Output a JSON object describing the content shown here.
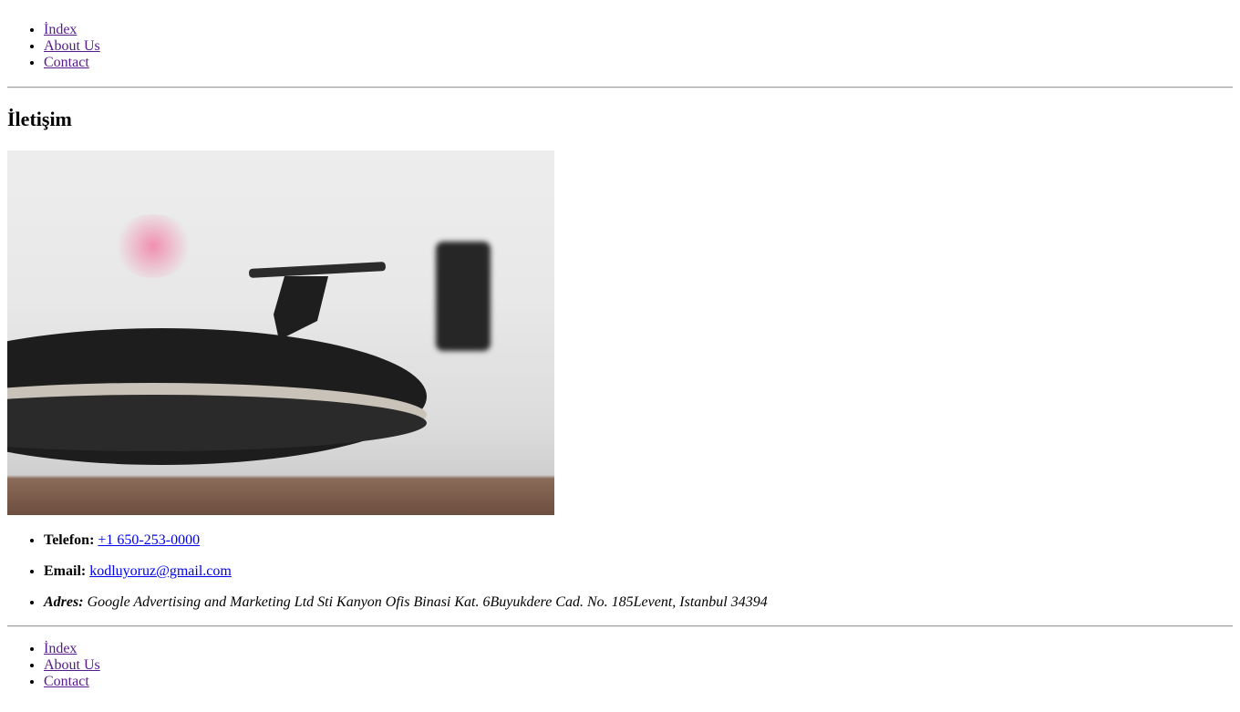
{
  "nav": {
    "items": [
      {
        "label": "İndex"
      },
      {
        "label": "About Us"
      },
      {
        "label": "Contact"
      }
    ]
  },
  "page": {
    "title": "İletişim"
  },
  "image": {
    "icon": "turntable-photo"
  },
  "contact": {
    "phone_label": "Telefon:",
    "phone_value": "+1 650-253-0000",
    "email_label": "Email:",
    "email_value": "kodluyoruz@gmail.com",
    "address_label": "Adres:",
    "address_value": "Google Advertising and Marketing Ltd Sti Kanyon Ofis Binasi Kat. 6Buyukdere Cad. No. 185Levent, Istanbul 34394"
  },
  "colors": {
    "visited_link": "#551a8b",
    "link": "#0000ee"
  }
}
